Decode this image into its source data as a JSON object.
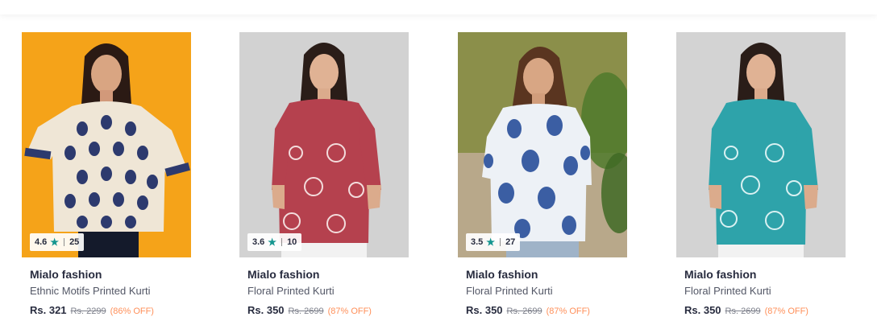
{
  "products": [
    {
      "brand": "Mialo fashion",
      "name": "Ethnic Motifs Printed Kurti",
      "price": "Rs. 321",
      "mrp": "Rs. 2299",
      "discount": "(86% OFF)",
      "rating": "4.6",
      "rating_count": "25",
      "image": "woman-ethnic-motif-kurti"
    },
    {
      "brand": "Mialo fashion",
      "name": "Floral Printed Kurti",
      "price": "Rs. 350",
      "mrp": "Rs. 2699",
      "discount": "(87% OFF)",
      "rating": "3.6",
      "rating_count": "10",
      "image": "woman-red-floral-kurti"
    },
    {
      "brand": "Mialo fashion",
      "name": "Floral Printed Kurti",
      "price": "Rs. 350",
      "mrp": "Rs. 2699",
      "discount": "(87% OFF)",
      "rating": "3.5",
      "rating_count": "27",
      "image": "woman-blue-floral-kurti"
    },
    {
      "brand": "Mialo fashion",
      "name": "Floral Printed Kurti",
      "price": "Rs. 350",
      "mrp": "Rs. 2699",
      "discount": "(87% OFF)",
      "image": "woman-teal-floral-kurti"
    }
  ],
  "colors": {
    "star": "#14958f",
    "discount": "#ff905a",
    "brand_text": "#282c3f"
  },
  "icons": {
    "rating": "star-icon"
  }
}
